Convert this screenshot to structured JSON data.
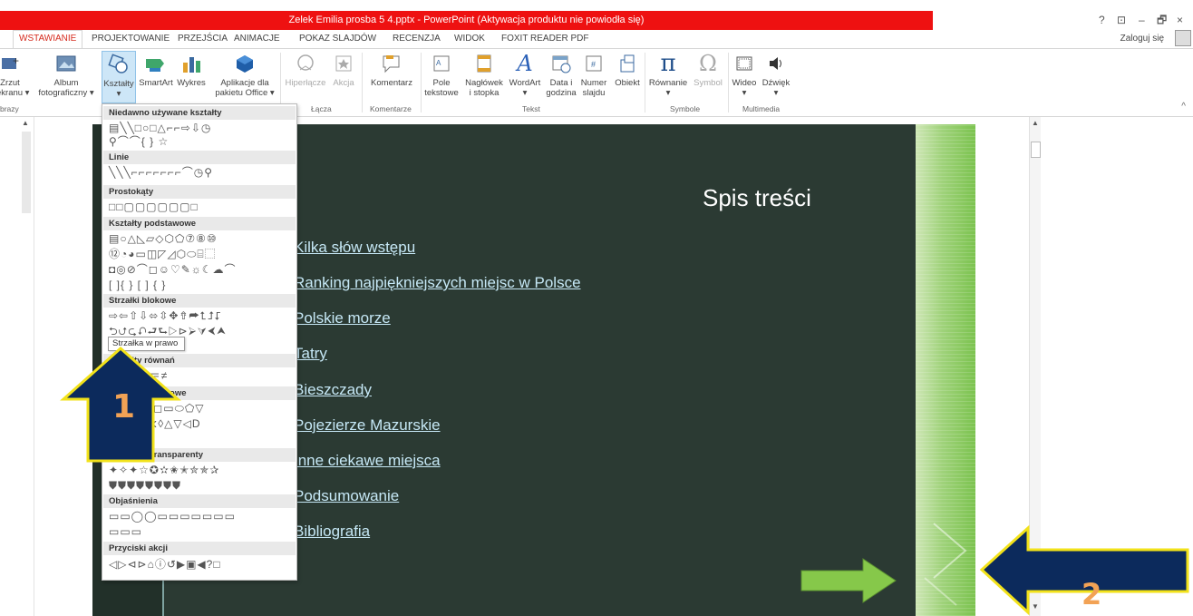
{
  "window": {
    "title": "Zelek Emilia prosba 5 4.pptx - PowerPoint (Aktywacja produktu nie powiodła się)",
    "controls": [
      "?",
      "⊡",
      "–",
      "🗗",
      "×"
    ]
  },
  "tabs": [
    "WSTAWIANIE",
    "PROJEKTOWANIE",
    "PRZEJŚCIA",
    "ANIMACJE",
    "POKAZ SLAJDÓW",
    "RECENZJA",
    "WIDOK",
    "FOXIT READER PDF"
  ],
  "login": "Zaloguj się",
  "ribbon": {
    "buttons": [
      {
        "label": "Zrzut\nekranu ▾",
        "icon": "screenshot-icon"
      },
      {
        "label": "Album\nfotograficzny ▾",
        "icon": "photo-album-icon"
      },
      {
        "label": "Kształty\n▾",
        "icon": "shapes-icon"
      },
      {
        "label": "SmartArt",
        "icon": "smartart-icon"
      },
      {
        "label": "Wykres",
        "icon": "chart-icon"
      },
      {
        "label": "Aplikacje dla\npakietu Office ▾",
        "icon": "office-apps-icon"
      },
      {
        "label": "Hiperłącze",
        "icon": "hyperlink-icon"
      },
      {
        "label": "Akcja",
        "icon": "action-icon"
      },
      {
        "label": "Komentarz",
        "icon": "comment-icon"
      },
      {
        "label": "Pole\ntekstowe",
        "icon": "textbox-icon"
      },
      {
        "label": "Nagłówek\ni stopka",
        "icon": "header-footer-icon"
      },
      {
        "label": "WordArt\n▾",
        "icon": "wordart-icon"
      },
      {
        "label": "Data i\ngodzina",
        "icon": "date-time-icon"
      },
      {
        "label": "Numer\nslajdu",
        "icon": "slide-number-icon"
      },
      {
        "label": "Obiekt",
        "icon": "object-icon"
      },
      {
        "label": "Równanie\n▾",
        "icon": "equation-icon"
      },
      {
        "label": "Symbol",
        "icon": "symbol-icon"
      },
      {
        "label": "Wideo\n▾",
        "icon": "video-icon"
      },
      {
        "label": "Dźwięk\n▾",
        "icon": "audio-icon"
      }
    ],
    "groups": [
      "brazy",
      "Łącza",
      "Komentarze",
      "Tekst",
      "Symbole",
      "Multimedia"
    ]
  },
  "slide": {
    "title": "Spis treści",
    "toc": [
      "Kilka słów wstępu",
      "Ranking najpiękniejszych miejsc w Polsce",
      "Polskie morze",
      "Tatry",
      "Bieszczady",
      "Pojezierze Mazurskie",
      "Inne ciekawe miejsca",
      "Podsumowanie",
      "Bibliografia"
    ]
  },
  "shapes_menu": {
    "sections": [
      {
        "header": "Niedawno używane kształty",
        "rows": [
          "▤╲╲□○□△⌐⌐⇨⇩◷",
          "⚲⌒⌒{ } ☆"
        ]
      },
      {
        "header": "Linie",
        "rows": [
          "╲╲╲⌐⌐⌐⌐⌐⌐⌐⌒◷⚲"
        ]
      },
      {
        "header": "Prostokąty",
        "rows": [
          "□□▢▢▢▢▢▢□"
        ]
      },
      {
        "header": "Kształty podstawowe",
        "rows": [
          "▤○△◺▱◇⬡⬠⑦⑧⑩",
          "⑫◔◕▭◫◸◿⬡⬭⌸⬚",
          "◘◎⊘⌒◻☺♡✎☼☾☁⌒",
          "[ ]{ } [ ] { }"
        ]
      },
      {
        "header": "Strzałki blokowe",
        "rows": [
          "⇨⇦⇧⇩⬄⇳✥⇮⮫⮤⮥⮦",
          "⮌⮍⮎⮏⮐⮑▷⊳⮚⮛⮜⮝"
        ]
      },
      {
        "header": "Kształty równań",
        "rows": [
          "＋－✕÷＝≠"
        ]
      },
      {
        "header": "Schematy blokowe",
        "rows": [
          "□◇▱□◫◻▭⬭⬠▽",
          "○◯⊗⊕⧖◊△▽◁D",
          "◯⬭"
        ]
      },
      {
        "header": "Gwiazdy i transparenty",
        "rows": [
          "✦✧✦☆✪✫✬✭✮✯✰",
          "⛊⛊⛊⛊⛊⛊⛊⛊"
        ]
      },
      {
        "header": "Objaśnienia",
        "rows": [
          "▭▭◯◯▭▭▭▭▭▭▭",
          "▭▭▭"
        ]
      },
      {
        "header": "Przyciski akcji",
        "rows": [
          "◁▷⊲⊳⌂ⓘ↺▶▣◀?□"
        ]
      }
    ],
    "tooltip": "Strzałka w prawo"
  },
  "annotations": {
    "arrow_1_label": "1",
    "arrow_2_label": "2",
    "arrow_fill": "#0c2a5c",
    "arrow_outline": "#f2e21a",
    "label_color": "#f2a255",
    "green_arrow": "#86c84a"
  }
}
